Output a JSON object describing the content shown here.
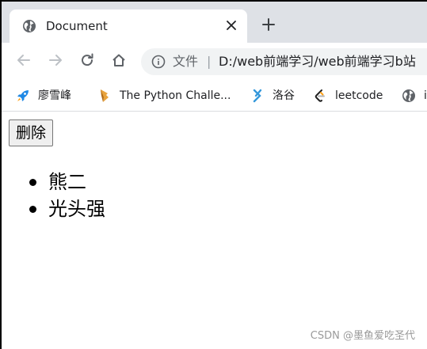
{
  "tab": {
    "title": "Document",
    "favicon": "globe-icon",
    "close_icon": "close-icon"
  },
  "new_tab_icon": "plus-icon",
  "toolbar": {
    "back_icon": "back-arrow-icon",
    "forward_icon": "forward-arrow-icon",
    "reload_icon": "reload-icon",
    "home_icon": "home-icon"
  },
  "omnibox": {
    "info_icon": "info-icon",
    "label": "文件",
    "separator": "|",
    "url": "D:/web前端学习/web前端学习b站"
  },
  "bookmarks": [
    {
      "label": "廖雪峰",
      "icon": "rocket-icon"
    },
    {
      "label": "The Python Challe...",
      "icon": "python-challenge-icon"
    },
    {
      "label": "洛谷",
      "icon": "luogu-icon"
    },
    {
      "label": "leetcode",
      "icon": "leetcode-icon"
    },
    {
      "label": "i",
      "icon": "globe-icon"
    }
  ],
  "page": {
    "delete_label": "删除",
    "items": [
      "熊二",
      "光头强"
    ]
  },
  "watermark": "CSDN @墨鱼爱吃圣代",
  "colors": {
    "tabstrip": "#dee1e6",
    "omnibox": "#f1f3f4",
    "leetcode_orange": "#ffa116",
    "rocket_blue": "#1e88e5"
  }
}
